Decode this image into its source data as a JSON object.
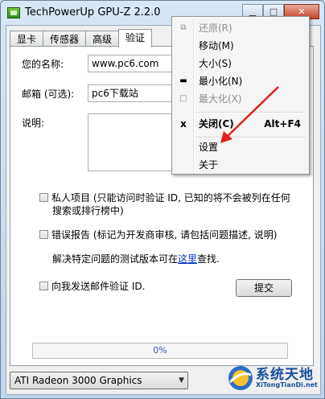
{
  "window": {
    "title": "TechPowerUp GPU-Z 2.2.0",
    "min_glyph": "▁",
    "max_glyph": "□",
    "close_glyph": "✕"
  },
  "tabs": [
    {
      "label": "显卡"
    },
    {
      "label": "传感器"
    },
    {
      "label": "高级"
    },
    {
      "label": "验证"
    }
  ],
  "form": {
    "name_label": "您的名称:",
    "name_value": "www.pc6.com",
    "email_label": "邮箱 (可选):",
    "email_value": "pc6下载站",
    "desc_label": "说明:"
  },
  "options": {
    "private_label": "私人项目 (只能访问时验证 ID, 已知的将不会被列在任何",
    "private_label_line2": "搜索或排行榜中)",
    "error_report_label": "错误报告 (标记为开发商审核, 请包括问题描述, 说明)",
    "test_version_prefix": "解决特定问题的测试版本可在",
    "test_version_link": "这里",
    "test_version_suffix": "查找.",
    "email_id_label": "向我发送邮件验证 ID."
  },
  "submit_label": "提交",
  "progress": {
    "value": 0,
    "text": "0%"
  },
  "gpu_select": {
    "selected": "ATI Radeon 3000 Graphics",
    "arrow": "▼"
  },
  "context_menu": {
    "items": [
      {
        "icon": "⧉",
        "label": "还原(R)",
        "shortcut": "",
        "disabled": true
      },
      {
        "icon": "",
        "label": "移动(M)",
        "shortcut": "",
        "disabled": false
      },
      {
        "icon": "",
        "label": "大小(S)",
        "shortcut": "",
        "disabled": false
      },
      {
        "icon": "▬",
        "label": "最小化(N)",
        "shortcut": "",
        "disabled": false
      },
      {
        "icon": "□",
        "label": "最大化(X)",
        "shortcut": "",
        "disabled": true
      },
      {
        "icon": "x",
        "label": "关闭(C)",
        "shortcut": "Alt+F4",
        "disabled": false
      },
      {
        "icon": "",
        "label": "设置",
        "shortcut": "",
        "disabled": false
      },
      {
        "icon": "",
        "label": "关于",
        "shortcut": "",
        "disabled": false
      }
    ]
  },
  "watermark": {
    "title": "系统天地",
    "subtitle": "XiTongTianDi.net"
  },
  "colors": {
    "annotation_arrow": "#e02020",
    "link": "#0033cc",
    "progress_text": "#3b5dab"
  }
}
